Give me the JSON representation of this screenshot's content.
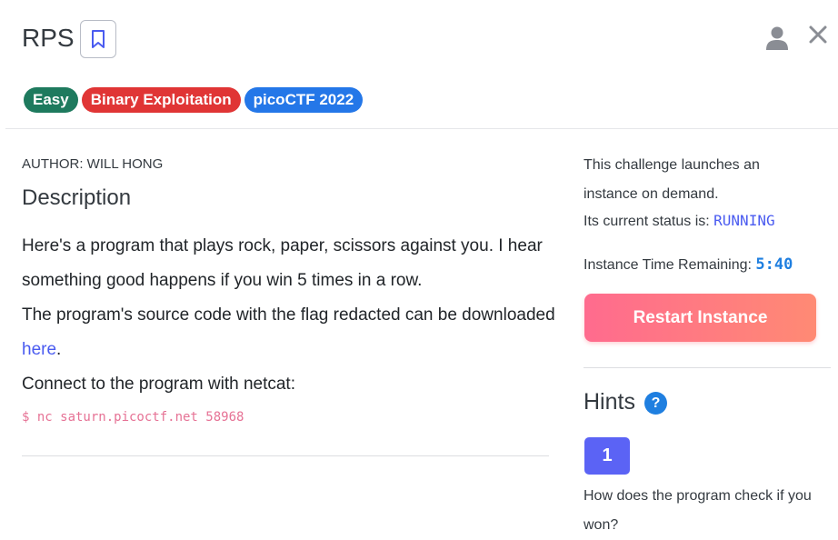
{
  "header": {
    "title": "RPS"
  },
  "tags": {
    "difficulty": "Easy",
    "category": "Binary Exploitation",
    "event": "picoCTF 2022"
  },
  "main": {
    "author": "AUTHOR: WILL HONG",
    "description_heading": "Description",
    "paragraph_1": "Here's a program that plays rock, paper, scissors against you. I hear something good happens if you win 5 times in a row.",
    "paragraph_2_prefix": "The program's source code with the flag redacted can be downloaded ",
    "paragraph_2_link": "here",
    "paragraph_2_suffix": ".",
    "paragraph_3": "Connect to the program with netcat:",
    "command": "$ nc saturn.picoctf.net 58968"
  },
  "sidebar": {
    "launch_text": "This challenge launches an instance on demand.",
    "status_label": "Its current status is: ",
    "status_value": "RUNNING",
    "time_label": "Instance Time Remaining: ",
    "time_value": "5:40",
    "restart_label": "Restart Instance",
    "hints_heading": "Hints",
    "help_symbol": "?",
    "hint_number": "1",
    "hint_text": "How does the program check if you won?"
  },
  "colors": {
    "difficulty_tag": "#1e7a5e",
    "category_tag": "#e03535",
    "event_tag": "#2477e8",
    "accent": "#5b63f5",
    "command_text": "#e67295"
  },
  "icons": [
    "bookmark-icon",
    "user-icon",
    "close-icon",
    "help-icon"
  ]
}
